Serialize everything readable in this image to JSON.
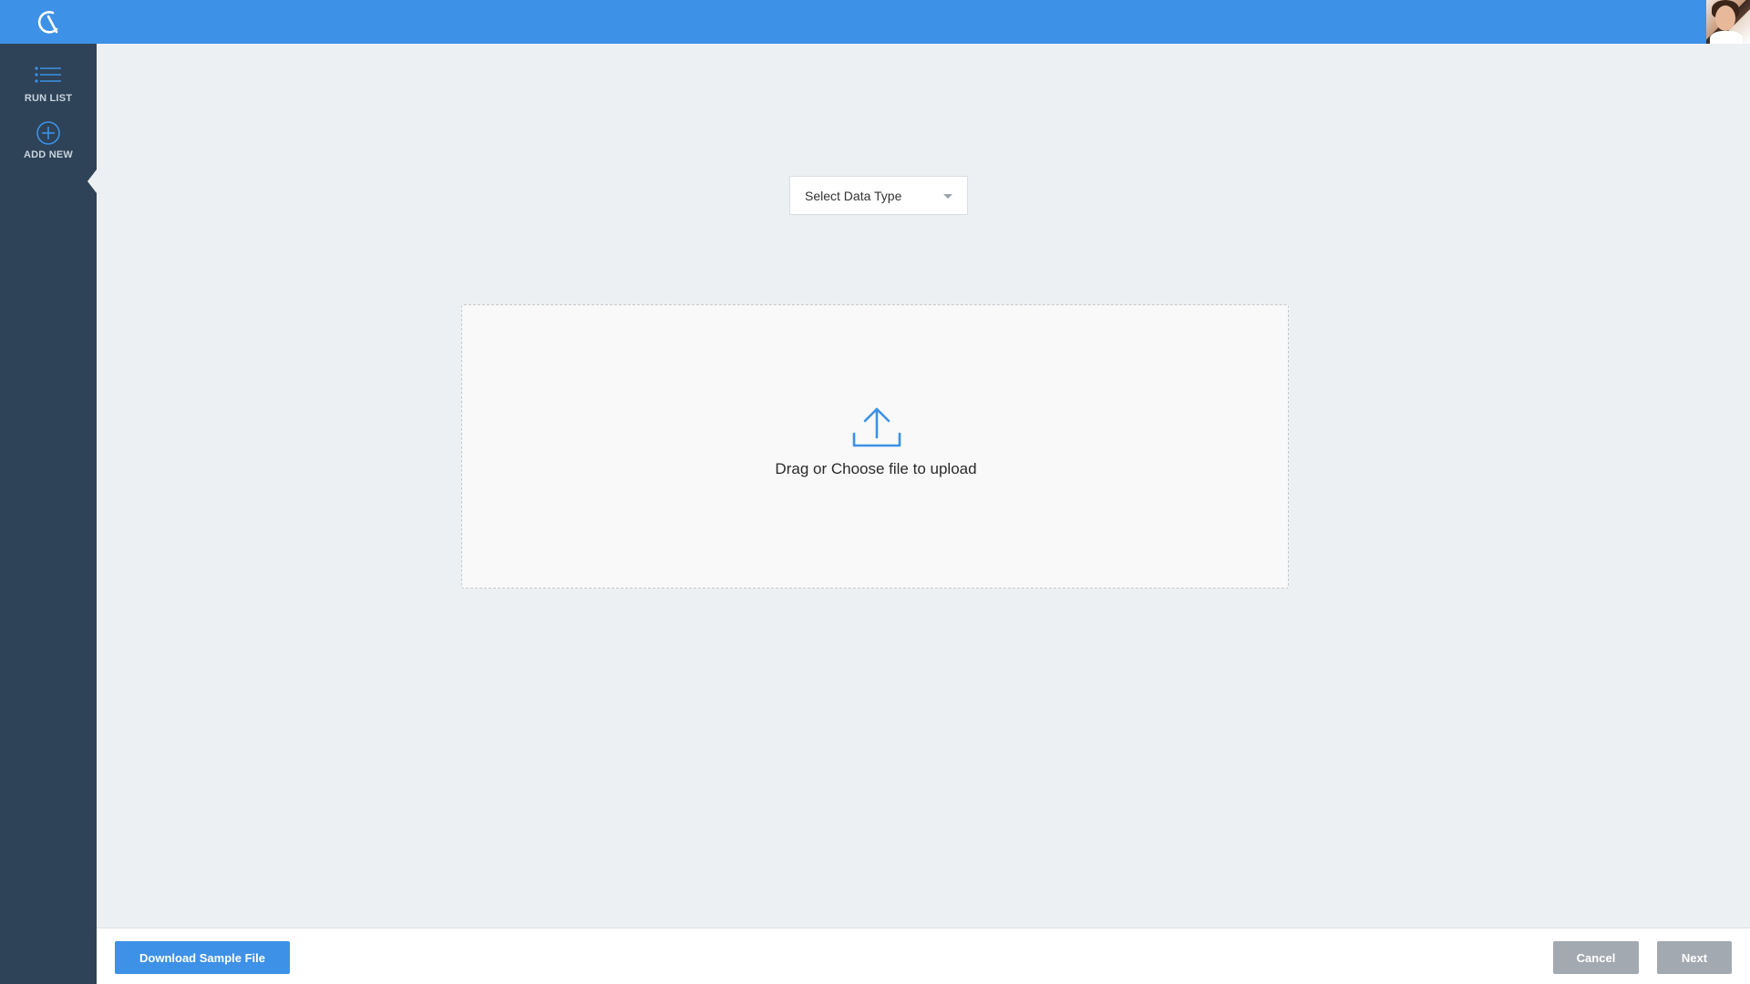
{
  "app": {
    "brand_color": "#3d91e6",
    "sidebar_color": "#2e4357"
  },
  "sidebar": {
    "items": [
      {
        "label": "RUN LIST",
        "icon": "list-icon"
      },
      {
        "label": "ADD NEW",
        "icon": "plus-circle-icon"
      }
    ]
  },
  "main": {
    "data_type_select": {
      "selected": "Select Data Type"
    },
    "dropzone": {
      "text": "Drag or Choose file to upload",
      "icon": "upload-icon"
    }
  },
  "footer": {
    "download_label": "Download Sample File",
    "cancel_label": "Cancel",
    "next_label": "Next"
  }
}
